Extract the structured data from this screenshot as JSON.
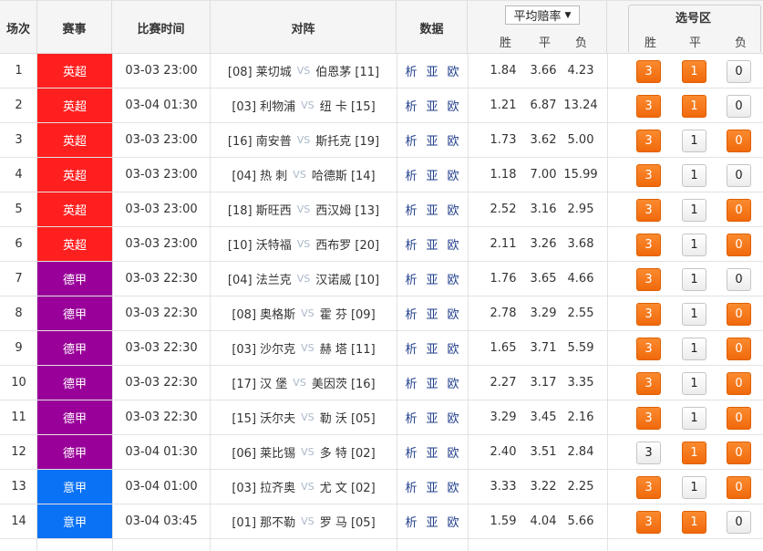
{
  "header": {
    "col_index": "场次",
    "col_league": "赛事",
    "col_time": "比赛时间",
    "col_match": "对阵",
    "col_data": "数据",
    "odds_select": "平均赔率",
    "odds_select_arrow": "▼",
    "odds_sub": [
      "胜",
      "平",
      "负"
    ],
    "pick_title": "选号区",
    "pick_sub": [
      "胜",
      "平",
      "负"
    ]
  },
  "vs_text": "VS",
  "data_links": [
    "析",
    "亚",
    "欧"
  ],
  "colors": {
    "epl": "#ff1f1f",
    "bundesliga": "#990099",
    "seriea": "#0a72f5",
    "selected": "#f47816"
  },
  "rows": [
    {
      "no": "1",
      "league": "英超",
      "league_key": "epl",
      "time": "03-03 23:00",
      "home": "[08] 莱切城",
      "away": "伯恩茅 [11]",
      "odds": [
        "1.84",
        "3.66",
        "4.23"
      ],
      "picks": [
        {
          "label": "3",
          "on": true
        },
        {
          "label": "1",
          "on": true
        },
        {
          "label": "0",
          "on": false
        }
      ]
    },
    {
      "no": "2",
      "league": "英超",
      "league_key": "epl",
      "time": "03-04 01:30",
      "home": "[03] 利物浦",
      "away": "纽 卡 [15]",
      "odds": [
        "1.21",
        "6.87",
        "13.24"
      ],
      "picks": [
        {
          "label": "3",
          "on": true
        },
        {
          "label": "1",
          "on": true
        },
        {
          "label": "0",
          "on": false
        }
      ]
    },
    {
      "no": "3",
      "league": "英超",
      "league_key": "epl",
      "time": "03-03 23:00",
      "home": "[16] 南安普",
      "away": "斯托克 [19]",
      "odds": [
        "1.73",
        "3.62",
        "5.00"
      ],
      "picks": [
        {
          "label": "3",
          "on": true
        },
        {
          "label": "1",
          "on": false
        },
        {
          "label": "0",
          "on": true
        }
      ]
    },
    {
      "no": "4",
      "league": "英超",
      "league_key": "epl",
      "time": "03-03 23:00",
      "home": "[04] 热 刺",
      "away": "哈德斯 [14]",
      "odds": [
        "1.18",
        "7.00",
        "15.99"
      ],
      "picks": [
        {
          "label": "3",
          "on": true
        },
        {
          "label": "1",
          "on": false
        },
        {
          "label": "0",
          "on": false
        }
      ]
    },
    {
      "no": "5",
      "league": "英超",
      "league_key": "epl",
      "time": "03-03 23:00",
      "home": "[18] 斯旺西",
      "away": "西汉姆 [13]",
      "odds": [
        "2.52",
        "3.16",
        "2.95"
      ],
      "picks": [
        {
          "label": "3",
          "on": true
        },
        {
          "label": "1",
          "on": false
        },
        {
          "label": "0",
          "on": true
        }
      ]
    },
    {
      "no": "6",
      "league": "英超",
      "league_key": "epl",
      "time": "03-03 23:00",
      "home": "[10] 沃特福",
      "away": "西布罗 [20]",
      "odds": [
        "2.11",
        "3.26",
        "3.68"
      ],
      "picks": [
        {
          "label": "3",
          "on": true
        },
        {
          "label": "1",
          "on": false
        },
        {
          "label": "0",
          "on": true
        }
      ]
    },
    {
      "no": "7",
      "league": "德甲",
      "league_key": "bundesliga",
      "time": "03-03 22:30",
      "home": "[04] 法兰克",
      "away": "汉诺威 [10]",
      "odds": [
        "1.76",
        "3.65",
        "4.66"
      ],
      "picks": [
        {
          "label": "3",
          "on": true
        },
        {
          "label": "1",
          "on": false
        },
        {
          "label": "0",
          "on": false
        }
      ]
    },
    {
      "no": "8",
      "league": "德甲",
      "league_key": "bundesliga",
      "time": "03-03 22:30",
      "home": "[08] 奥格斯",
      "away": "霍 芬 [09]",
      "odds": [
        "2.78",
        "3.29",
        "2.55"
      ],
      "picks": [
        {
          "label": "3",
          "on": true
        },
        {
          "label": "1",
          "on": false
        },
        {
          "label": "0",
          "on": true
        }
      ]
    },
    {
      "no": "9",
      "league": "德甲",
      "league_key": "bundesliga",
      "time": "03-03 22:30",
      "home": "[03] 沙尔克",
      "away": "赫 塔 [11]",
      "odds": [
        "1.65",
        "3.71",
        "5.59"
      ],
      "picks": [
        {
          "label": "3",
          "on": true
        },
        {
          "label": "1",
          "on": false
        },
        {
          "label": "0",
          "on": true
        }
      ]
    },
    {
      "no": "10",
      "league": "德甲",
      "league_key": "bundesliga",
      "time": "03-03 22:30",
      "home": "[17] 汉 堡",
      "away": "美因茨 [16]",
      "odds": [
        "2.27",
        "3.17",
        "3.35"
      ],
      "picks": [
        {
          "label": "3",
          "on": true
        },
        {
          "label": "1",
          "on": false
        },
        {
          "label": "0",
          "on": true
        }
      ]
    },
    {
      "no": "11",
      "league": "德甲",
      "league_key": "bundesliga",
      "time": "03-03 22:30",
      "home": "[15] 沃尔夫",
      "away": "勒 沃 [05]",
      "odds": [
        "3.29",
        "3.45",
        "2.16"
      ],
      "picks": [
        {
          "label": "3",
          "on": true
        },
        {
          "label": "1",
          "on": false
        },
        {
          "label": "0",
          "on": true
        }
      ]
    },
    {
      "no": "12",
      "league": "德甲",
      "league_key": "bundesliga",
      "time": "03-04 01:30",
      "home": "[06] 莱比锡",
      "away": "多 特 [02]",
      "odds": [
        "2.40",
        "3.51",
        "2.84"
      ],
      "picks": [
        {
          "label": "3",
          "on": false
        },
        {
          "label": "1",
          "on": true
        },
        {
          "label": "0",
          "on": true
        }
      ]
    },
    {
      "no": "13",
      "league": "意甲",
      "league_key": "seriea",
      "time": "03-04 01:00",
      "home": "[03] 拉齐奥",
      "away": "尤 文 [02]",
      "odds": [
        "3.33",
        "3.22",
        "2.25"
      ],
      "picks": [
        {
          "label": "3",
          "on": true
        },
        {
          "label": "1",
          "on": false
        },
        {
          "label": "0",
          "on": true
        }
      ]
    },
    {
      "no": "14",
      "league": "意甲",
      "league_key": "seriea",
      "time": "03-04 03:45",
      "home": "[01] 那不勒",
      "away": "罗 马 [05]",
      "odds": [
        "1.59",
        "4.04",
        "5.66"
      ],
      "picks": [
        {
          "label": "3",
          "on": true
        },
        {
          "label": "1",
          "on": true
        },
        {
          "label": "0",
          "on": false
        }
      ]
    }
  ]
}
